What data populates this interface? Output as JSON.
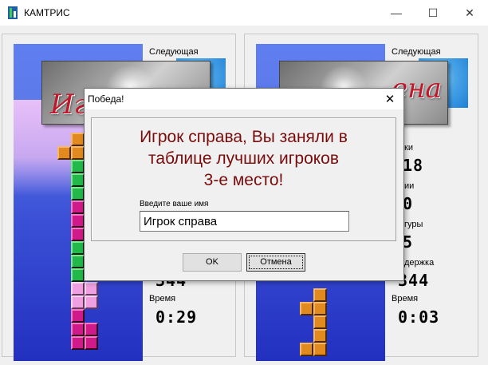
{
  "app": {
    "title": "КАМТРИС"
  },
  "window_controls": {
    "minimize": "—",
    "maximize": "☐",
    "close": "✕"
  },
  "left_panel": {
    "next_label": "Следующая",
    "time_label": "Время",
    "time_value": "0:29",
    "delay_value": "344"
  },
  "right_panel": {
    "next_label": "Следующая",
    "partial_labels": [
      "ки",
      "ии",
      "гуры",
      "держка"
    ],
    "partial_values": [
      "18",
      "0",
      "5"
    ],
    "delay_value": "344",
    "time_label": "Время",
    "time_value": "0:03"
  },
  "splash": {
    "left_text": "Игр",
    "right_text": "ена"
  },
  "dialog": {
    "title": "Победа!",
    "close": "✕",
    "message_line1": "Игрок справа, Вы заняли в",
    "message_line2": "таблице лучших игроков",
    "message_line3": "3-е место!",
    "name_label": "Введите ваше имя",
    "name_value": "Игрок справа",
    "ok_label": "OK",
    "cancel_label": "Отмена"
  },
  "colors": {
    "message": "#7a0b0b",
    "well_top": "#5f7ef0",
    "well_bottom": "#2230c0",
    "green_block": "#22b84a",
    "magenta_block": "#d11a8a",
    "pink_block": "#f0a0e0",
    "orange_block": "#e08a20"
  }
}
